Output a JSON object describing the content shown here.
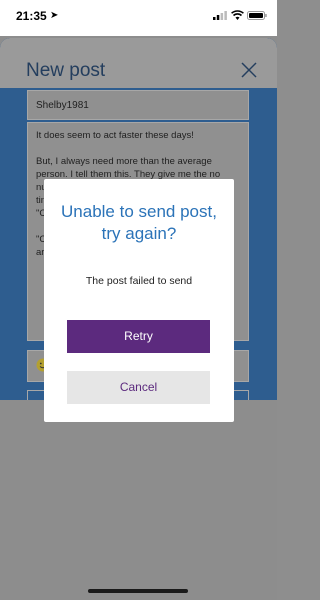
{
  "status_bar": {
    "time": "21:35",
    "icons": [
      "location-arrow-icon",
      "signal-icon",
      "wifi-icon",
      "battery-icon"
    ]
  },
  "background": {
    "title": "New post",
    "username": "Shelby1981",
    "post_paragraphs": [
      "It does seem to act faster these days!",
      "But, I always need more than the average person. I tell them this. They give me the no",
      "nu",
      "tin",
      "\"C",
      "\"C",
      "ar"
    ]
  },
  "dialog": {
    "title": "Unable to send post, try again?",
    "message": "The post failed to send",
    "retry_label": "Retry",
    "cancel_label": "Cancel"
  },
  "colors": {
    "title_blue": "#2b73b8",
    "button_purple": "#5c2a7e",
    "cancel_bg": "#e6e6e6"
  }
}
